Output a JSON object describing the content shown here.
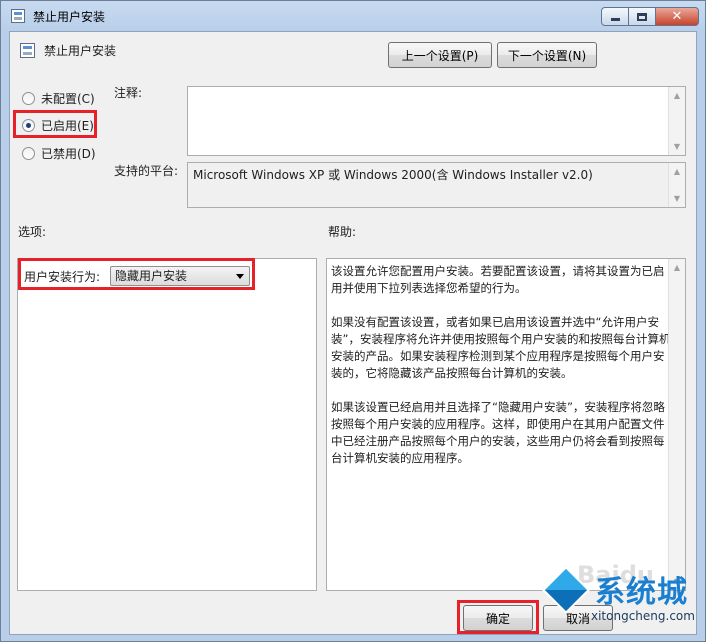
{
  "window": {
    "title": "禁止用户安装",
    "minimize_icon": "minimize-icon",
    "maximize_icon": "maximize-icon",
    "close_glyph": "✕"
  },
  "header": {
    "setting_name": "禁止用户安装",
    "prev_label": "上一个设置(P)",
    "next_label": "下一个设置(N)"
  },
  "state": {
    "options": [
      {
        "label": "未配置(C)",
        "checked": false
      },
      {
        "label": "已启用(E)",
        "checked": true
      },
      {
        "label": "已禁用(D)",
        "checked": false
      }
    ]
  },
  "comment": {
    "label": "注释:",
    "value": ""
  },
  "platform": {
    "label": "支持的平台:",
    "value": "Microsoft Windows XP 或 Windows 2000(含 Windows Installer v2.0)"
  },
  "options_panel": {
    "label": "选项:",
    "behavior_label": "用户安装行为:",
    "behavior_value": "隐藏用户安装"
  },
  "help_panel": {
    "label": "帮助:",
    "paragraphs": [
      "该设置允许您配置用户安装。若要配置该设置，请将其设置为已启用并使用下拉列表选择您希望的行为。",
      "如果没有配置该设置，或者如果已启用该设置并选中“允许用户安装”，安装程序将允许并使用按照每个用户安装的和按照每台计算机安装的产品。如果安装程序检测到某个应用程序是按照每个用户安装的，它将隐藏该产品按照每台计算机的安装。",
      "如果该设置已经启用并且选择了“隐藏用户安装”，安装程序将忽略按照每个用户安装的应用程序。这样，即使用户在其用户配置文件中已经注册产品按照每个用户的安装，这些用户仍将会看到按照每台计算机安装的应用程序。"
    ]
  },
  "footer": {
    "ok_label": "确定",
    "cancel_label": "取消"
  },
  "watermark": {
    "brand": "系统城",
    "url": "xitongcheng.com",
    "baidu": "Baidu"
  },
  "colors": {
    "highlight": "#e8202a",
    "titlebar": "#b9cfe9"
  }
}
